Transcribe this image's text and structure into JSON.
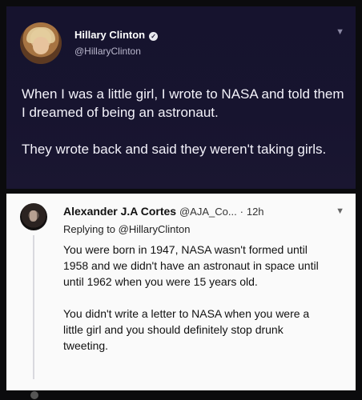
{
  "top_tweet": {
    "name": "Hillary Clinton",
    "handle": "@HillaryClinton",
    "verified_icon": "verified-badge-icon",
    "paragraphs": [
      "When I was a little girl, I wrote to NASA and told them I dreamed of being an astronaut.",
      "They wrote back and said they weren't taking girls."
    ],
    "chevron_icon": "chevron-down-icon"
  },
  "reply": {
    "name": "Alexander J.A Cortes",
    "handle": "@AJA_Co...",
    "separator": "·",
    "time": "12h",
    "replying_label": "Replying to",
    "replying_handle": "@HillaryClinton",
    "paragraphs": [
      "You were born in 1947, NASA wasn't formed until 1958 and we didn't have an astronaut in space until until 1962 when you were 15 years old.",
      "You didn't write a letter to NASA when you were a little girl and you should definitely stop drunk tweeting."
    ],
    "chevron_icon": "chevron-down-icon"
  },
  "colors": {
    "top_bg": "#16132e",
    "reply_bg": "#fafafa",
    "frame_bg": "#0b0b0d"
  }
}
